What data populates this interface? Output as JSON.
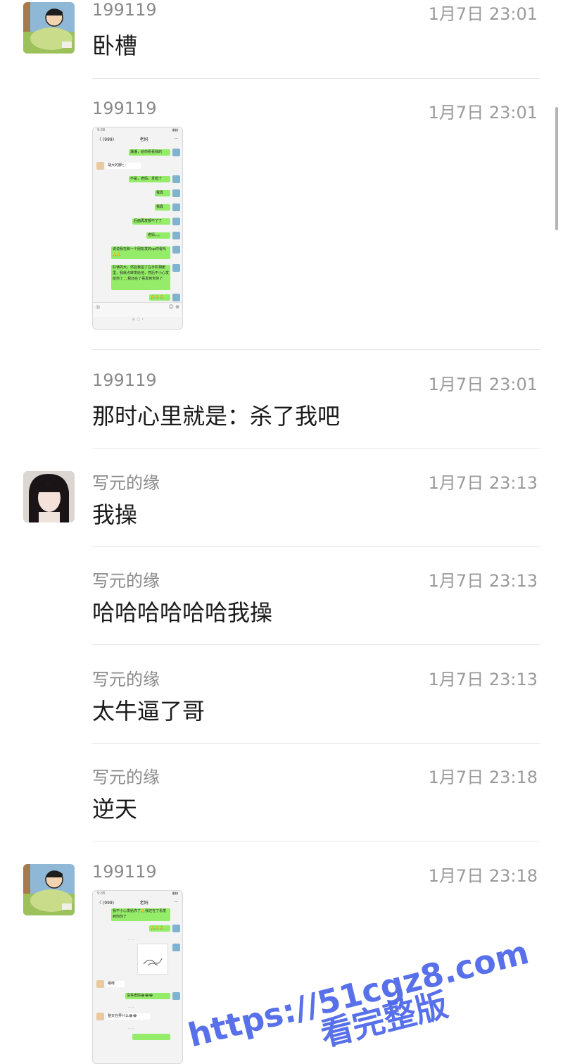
{
  "messages": [
    {
      "sender": "199119",
      "time": "1月7日 23:01",
      "text": "卧槽"
    },
    {
      "sender": "199119",
      "time": "1月7日 23:01",
      "text": ""
    },
    {
      "sender": "199119",
      "time": "1月7日 23:01",
      "text": "那时心里就是：杀了我吧"
    },
    {
      "sender": "写元的缘",
      "time": "1月7日 23:13",
      "text": "我操"
    },
    {
      "sender": "写元的缘",
      "time": "1月7日 23:13",
      "text": "哈哈哈哈哈哈我操"
    },
    {
      "sender": "写元的缘",
      "time": "1月7日 23:13",
      "text": "太牛逼了哥"
    },
    {
      "sender": "写元的缘",
      "time": "1月7日 23:18",
      "text": "逆天"
    },
    {
      "sender": "199119",
      "time": "1月7日 23:18",
      "text": ""
    }
  ],
  "screenshot1": {
    "back": "〈 (999)",
    "title": "老妈",
    "more": "···",
    "bubbles": [
      "潘潘，给你看看我的",
      "胡大的脚🐑",
      "不是，老妈，发错了",
      "我靠",
      "我靠",
      "后面再发都不了了",
      "老妈。。。",
      "说说我在和一个朋友发的cp你看吗🙏🙏",
      "好读的大，然后我拍了在手机相册里，我就点转发给他，然后不小心发给你了🙏我还在了看发到你你了",
      "🙏🙏🙏"
    ]
  },
  "screenshot2": {
    "back": "〈 (999)",
    "title": "老妈",
    "more": "···",
    "bubbles": [
      "我不小心发给你了🙏我还在了看发到你你了",
      "🙏🙏🙏",
      "嗯呀",
      "没事老妈😂😂😂",
      "整天在弄什么😂😂"
    ]
  },
  "watermark": {
    "url": "https://51cgz8.com",
    "caption": "看完整版"
  }
}
